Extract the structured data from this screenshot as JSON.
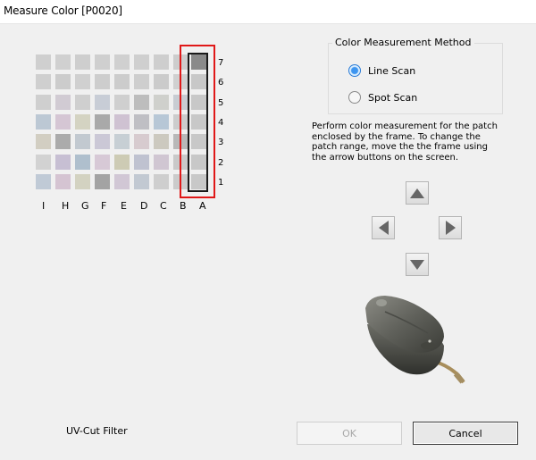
{
  "window": {
    "title": "Measure Color [P0020]"
  },
  "chart": {
    "row_labels": [
      "7",
      "6",
      "5",
      "4",
      "3",
      "2",
      "1"
    ],
    "col_labels": [
      "I",
      "H",
      "G",
      "F",
      "E",
      "D",
      "C",
      "B",
      "A"
    ],
    "patch_colors": [
      [
        "#cfcfcf",
        "#d0d0d0",
        "#cecece",
        "#cfcfcf",
        "#d0d0d0",
        "#cfcfcf",
        "#cecece",
        "#cdcdcd",
        "#8a8a8a"
      ],
      [
        "#cfcfcf",
        "#cccccc",
        "#d0d0d0",
        "#cdcdcd",
        "#cccccc",
        "#cecece",
        "#cbcbcb",
        "#d0d0d0",
        "#c8c8c8"
      ],
      [
        "#cfcfcf",
        "#d1cbd3",
        "#cfcfcf",
        "#c8cdd6",
        "#cfcfcf",
        "#bdbdbd",
        "#cfd0cc",
        "#c8ccd2",
        "#c8c8c8"
      ],
      [
        "#bcc8d4",
        "#d5c6d4",
        "#d4d3c2",
        "#a9a9a9",
        "#cfc2d2",
        "#bfbfc4",
        "#b7c7d6",
        "#cccccc",
        "#c8c8c8"
      ],
      [
        "#d2cec2",
        "#ababab",
        "#c2c9d0",
        "#cbc8d6",
        "#c7cfd4",
        "#d7cbcf",
        "#ccc9bf",
        "#b8b8b8",
        "#c8c8c8"
      ],
      [
        "#d2d2d2",
        "#c7bfd3",
        "#afbfcd",
        "#d7c9d6",
        "#cdcbb4",
        "#bfc2d0",
        "#d0c6d2",
        "#c9c9c9",
        "#c8c8c8"
      ],
      [
        "#c0cad6",
        "#d5c4d2",
        "#d3d2c1",
        "#a3a3a3",
        "#d1c7d5",
        "#c2c9d2",
        "#cecece",
        "#cbcbcb",
        "#c8c8c8"
      ]
    ]
  },
  "measurement_method": {
    "title": "Color Measurement Method",
    "options": [
      {
        "label": "Line Scan",
        "checked": true
      },
      {
        "label": "Spot Scan",
        "checked": false
      }
    ]
  },
  "description": "Perform color measurement for the patch enclosed by the frame. To change the patch range, move the the frame using the arrow buttons on the screen.",
  "arrows": {
    "up": "arrow-up-icon",
    "down": "arrow-down-icon",
    "left": "arrow-left-icon",
    "right": "arrow-right-icon"
  },
  "uv_cut_filter_label": "UV-Cut Filter",
  "buttons": {
    "ok": "OK",
    "cancel": "Cancel"
  },
  "colors": {
    "frame_red": "#e01818",
    "radio_blue": "#3d95f0",
    "background": "#f0f0f0"
  }
}
